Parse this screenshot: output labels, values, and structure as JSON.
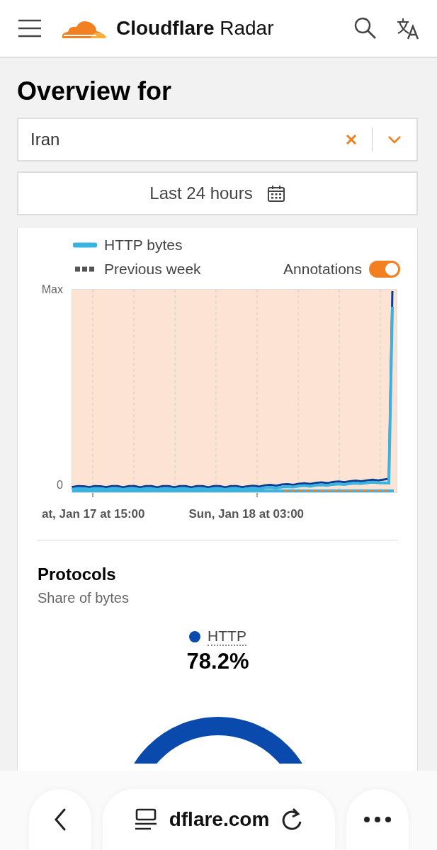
{
  "header": {
    "title_bold": "Cloudflare",
    "title_light": "Radar"
  },
  "page_title": "Overview for",
  "location_select": {
    "value": "Iran"
  },
  "date_range": {
    "label": "Last 24 hours"
  },
  "traffic_chart": {
    "legend": [
      {
        "label": "HTTP bytes",
        "kind": "solid",
        "color": "#3bb3e0"
      },
      {
        "label": "Previous week",
        "kind": "dashed",
        "color": "#555555"
      }
    ],
    "annotations_toggle": {
      "label": "Annotations",
      "on": true
    },
    "y_axis_labels": [
      "Max",
      "0"
    ],
    "x_axis_labels": [
      "at, Jan 17 at 15:00",
      "Sun, Jan 18 at 03:00"
    ]
  },
  "protocols": {
    "title": "Protocols",
    "subtitle": "Share of bytes",
    "legend": {
      "label": "HTTP",
      "color": "#0a4aad",
      "value": "78.2%"
    }
  },
  "browser_bar": {
    "url": "dflare.com"
  }
}
